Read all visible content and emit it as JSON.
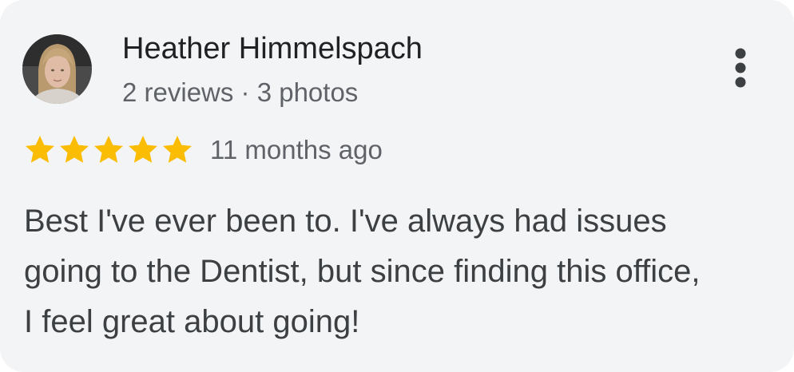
{
  "review": {
    "reviewer_name": "Heather Himmelspach",
    "reviewer_meta": "2 reviews · 3 photos",
    "rating": 5,
    "rating_max": 5,
    "date": "11 months ago",
    "text_lines": [
      "Best I've ever been to. I've always had issues",
      "going to the Dentist, but since finding this office,",
      "I feel great about going!"
    ]
  },
  "icons": {
    "avatar": "avatar-photo",
    "star": "star-icon",
    "more": "more-vert-icon"
  },
  "colors": {
    "card_background": "#f3f4f6",
    "star_fill": "#fbbc04",
    "name_text": "#202124",
    "secondary_text": "#5f6368",
    "body_text": "#3c4043",
    "more_icon": "#3c4043"
  }
}
